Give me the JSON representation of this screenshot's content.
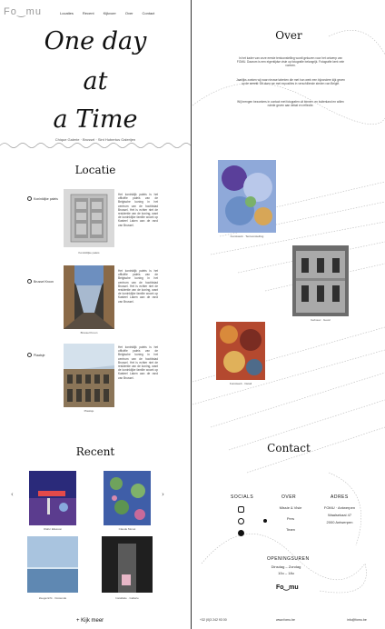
{
  "brand": {
    "logo": "Fo‿mu"
  },
  "nav": [
    "Locaties",
    "Recent",
    "Kijkvoer",
    "Over",
    "Contact"
  ],
  "hero": {
    "line1": "One day",
    "line2": "at",
    "line3": "a Time",
    "subline": "Chique Galerie · Brussel · Sint Hubertus Galerijen"
  },
  "locations": {
    "title": "Locatie",
    "items": [
      {
        "label": "Koninklijke paleis",
        "caption": "Koninklijke paleis"
      },
      {
        "label": "Brussel Kroon",
        "caption": "Brussel Kroon"
      },
      {
        "label": "Plaatsje",
        "caption": "Plaatsje"
      }
    ],
    "text": "Het koninklijk paleis is het officiële paleis van de Belgische koning in het centrum van de hoofdstad Brussel. Het is echter niet de residentie van de koning, want de koninklijke familie woont op Kasteel Laken aan de rand van Brussel."
  },
  "recent": {
    "title": "Recent",
    "items": [
      "Olafur Eliasson",
      "Claude Monet",
      "Zeegezicht · Oostende",
      "Installatie · Gallerie"
    ],
    "more": "+ Kijk meer"
  },
  "about": {
    "title": "Over",
    "paragraphs": [
      "In het kader van onze eerste tentoonstelling wordt gekozen voor het ontwerp van FOMU. Daarom is een eigentijdse visie op fotografie belangrijk. Fotografie kent vele vormen.",
      "Jaarlijks zoeken wij naar nieuwe talenten die met hun werk een bijzondere kijk geven op de wereld. Dit doen we met exposities in verschillende steden van België.",
      "Wij brengen bezoekers in contact met fotografen uit binnen- en buitenland en willen ruimte geven aan debat en reflectie."
    ],
    "captions": [
      "Kunstwerk · Tentoonstelling",
      "Gebouw · Gevel",
      "Kunstwerk · Detail"
    ]
  },
  "contact": {
    "title": "Contact",
    "socials_h": "SOCIALS",
    "over_h": "OVER",
    "over_items": [
      "Missie & Visie",
      "Pers",
      "Team"
    ],
    "adres_h": "ADRES",
    "adres_lines": [
      "FOMU · Antwerpen",
      "Waalsekaai 47",
      "2000 Antwerpen"
    ],
    "hours_h": "OPENINGSUREN",
    "hours_lines": [
      "Dinsdag – Zondag",
      "10u – 18u"
    ],
    "logo": "Fo‿mu",
    "footer": [
      "+32 (0)3 242 93 00",
      "www.fomu.be",
      "info@fomu.be"
    ]
  },
  "colors": {
    "accent": "#111111",
    "muted": "#777777"
  }
}
